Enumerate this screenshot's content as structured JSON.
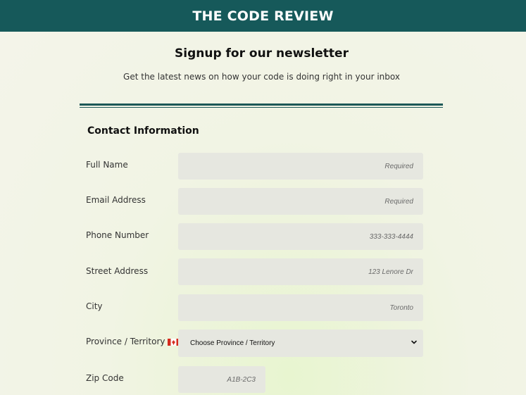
{
  "header": {
    "title": "THE CODE REVIEW"
  },
  "main": {
    "title": "Signup for our newsletter",
    "subtitle": "Get the latest news on how your code is doing right in your inbox"
  },
  "form": {
    "section_title": "Contact Information",
    "fields": {
      "full_name": {
        "label": "Full Name",
        "placeholder": "Required"
      },
      "email": {
        "label": "Email Address",
        "placeholder": "Required"
      },
      "phone": {
        "label": "Phone Number",
        "placeholder": "333-333-4444"
      },
      "street": {
        "label": "Street Address",
        "placeholder": "123 Lenore Dr"
      },
      "city": {
        "label": "City",
        "placeholder": "Toronto"
      },
      "province": {
        "label": "Province / Territory",
        "selected": "Choose Province / Territory",
        "flag_icon": "canada-flag-icon"
      },
      "zip": {
        "label": "Zip Code",
        "placeholder": "A1B-2C3"
      }
    }
  },
  "colors": {
    "header_bg": "#16595a",
    "field_bg": "#e6e7e0",
    "divider": "#1d5857"
  }
}
